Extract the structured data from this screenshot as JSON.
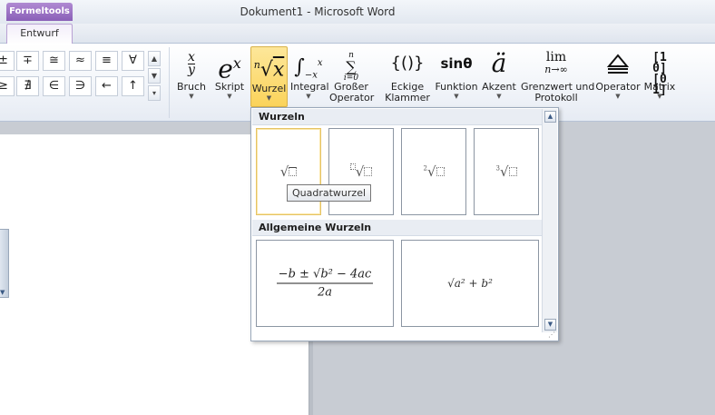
{
  "window": {
    "title": "Dokument1  -  Microsoft Word",
    "context_tab": "Formeltools",
    "active_tab": "Entwurf"
  },
  "ribbon": {
    "symbols": [
      "±",
      "∓",
      "≅",
      "≈",
      "≡",
      "∀",
      "≥",
      "∄",
      "∈",
      "∋",
      "←",
      "↑"
    ],
    "buttons": {
      "bruch": "Bruch",
      "skript": "Skript",
      "wurzel": "Wurzel",
      "integral": "Integral",
      "grosser_operator_1": "Großer",
      "grosser_operator_2": "Operator",
      "eckige_1": "Eckige",
      "eckige_2": "Klammer",
      "funktion": "Funktion",
      "akzent": "Akzent",
      "grenzwert_1": "Grenzwert und",
      "grenzwert_2": "Protokoll",
      "operator": "Operator",
      "matrix": "Matrix"
    },
    "glyphs": {
      "funktion": "sinθ",
      "akzent": "ä",
      "grenzwert_top": "lim",
      "grenzwert_bottom": "n→∞"
    }
  },
  "dropdown": {
    "section_wurzeln": "Wurzeln",
    "section_allgemein": "Allgemeine Wurzeln",
    "tooltip": "Quadratwurzel",
    "formula_quadratic_num": "−b ± √b² − 4ac",
    "formula_quadratic_den": "2a",
    "formula_pythagoras": "√a² + b²"
  }
}
